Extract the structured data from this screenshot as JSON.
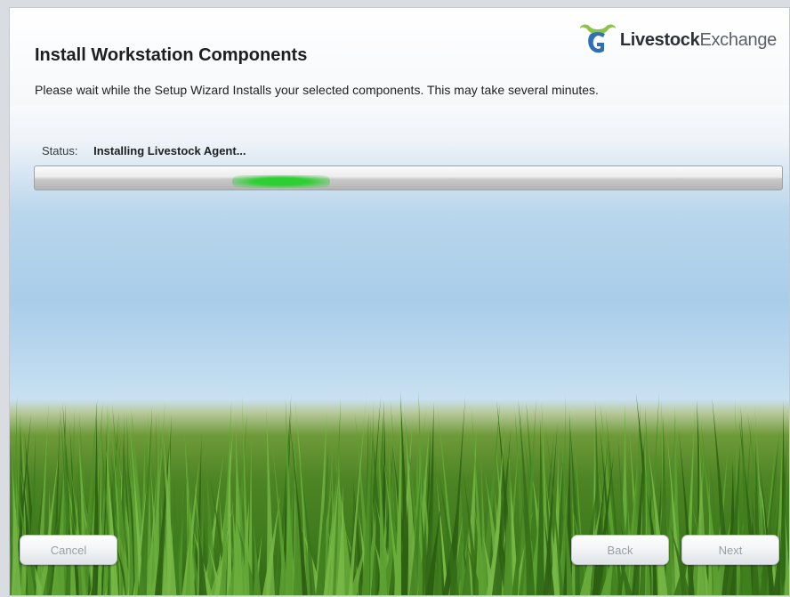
{
  "window": {
    "title": "Install Workstation Components",
    "subtitle": "Please wait while the Setup Wizard Installs your selected components.  This may take several minutes."
  },
  "logo": {
    "bold_text": "Livestock",
    "regular_text": "Exchange",
    "icon": "bull-horns-logo-icon",
    "colors": {
      "primary": "#2f6fb5",
      "accent": "#7cc242"
    }
  },
  "status": {
    "label": "Status:",
    "value": "Installing Livestock Agent..."
  },
  "progress": {
    "style": "indeterminate-marquee",
    "indicator_position": 0.33,
    "indicator_color": "#2ecf33"
  },
  "buttons": {
    "cancel": "Cancel",
    "back": "Back",
    "next": "Next"
  }
}
